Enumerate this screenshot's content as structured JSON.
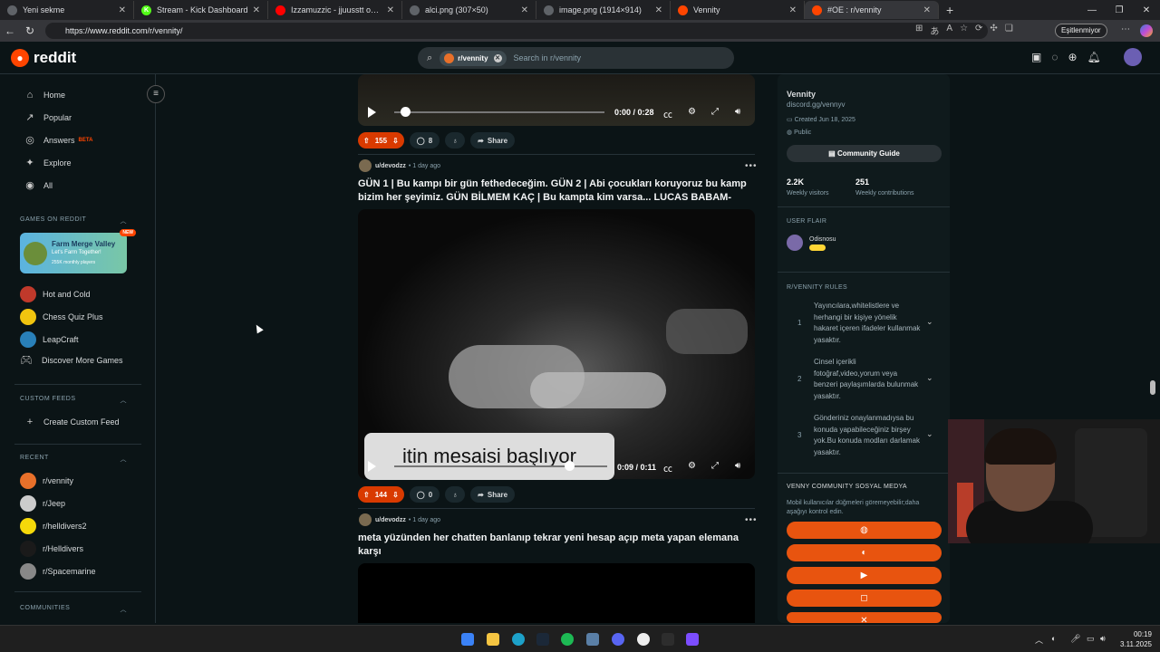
{
  "browser": {
    "tabs": [
      {
        "title": "Yeni sekme",
        "color": "#5f6368"
      },
      {
        "title": "Stream - Kick Dashboard",
        "color": "#53fc18",
        "glyph": "K"
      },
      {
        "title": "Izzamuzzic - jjuusstt oonnee (slo",
        "color": "#ff0000"
      },
      {
        "title": "alci.png (307×50)",
        "color": "#5f6368"
      },
      {
        "title": "image.png (1914×914)",
        "color": "#5f6368"
      },
      {
        "title": "Vennity",
        "color": "#ff4500"
      },
      {
        "title": "#OE : r/vennity",
        "color": "#ff4500"
      }
    ],
    "url": "https://www.reddit.com/r/vennity/",
    "sync_label": "Eşitlenmiyor"
  },
  "header": {
    "logo": "reddit",
    "search_chip": "r/vennity",
    "search_placeholder": "Search in r/vennity"
  },
  "sidebar": {
    "nav": [
      {
        "label": "Home",
        "icon": "home-icon",
        "glyph": "⌂"
      },
      {
        "label": "Popular",
        "icon": "popular-icon",
        "glyph": "↗"
      },
      {
        "label": "Answers",
        "icon": "answers-icon",
        "glyph": "◎"
      },
      {
        "label": "Explore",
        "icon": "explore-icon",
        "glyph": "✦"
      },
      {
        "label": "All",
        "icon": "all-icon",
        "glyph": "◉"
      }
    ],
    "answers_badge": "BETA",
    "games_header": "GAMES ON REDDIT",
    "promo": {
      "title": "Farm Merge Valley",
      "subtitle": "Let's Farm Together!",
      "meta": "255K monthly players",
      "badge": "NEW"
    },
    "games": [
      {
        "label": "Hot and Cold",
        "color": "#c0392b"
      },
      {
        "label": "Chess Quiz Plus",
        "color": "#f1c40f"
      },
      {
        "label": "LeapCraft",
        "color": "#2980b9"
      },
      {
        "label": "Discover More Games",
        "color": "#0b1416"
      }
    ],
    "custom_header": "CUSTOM FEEDS",
    "create_feed": "Create Custom Feed",
    "recent_header": "RECENT",
    "recent": [
      {
        "label": "r/vennity",
        "color": "#e8702a"
      },
      {
        "label": "r/Jeep",
        "color": "#cccccc"
      },
      {
        "label": "r/helldivers2",
        "color": "#f5d90a"
      },
      {
        "label": "r/Helldivers",
        "color": "#1a1a1a"
      },
      {
        "label": "r/Spacemarine",
        "color": "#888888"
      }
    ],
    "communities_header": "COMMUNITIES"
  },
  "feed": {
    "post0": {
      "time": "0:00 / 0:28",
      "votes": "155",
      "comments": "8",
      "share": "Share",
      "progress": 0.05
    },
    "post1": {
      "user": "u/devodzz",
      "age": "1 day ago",
      "title": "GÜN 1 | Bu kampı bir gün fethedeceğim. GÜN 2 | Abi çocukları koruyoruz bu kamp bizim her şeyimiz. GÜN BİLMEM KAÇ | Bu kampta kim varsa... LUCAS BABAM-",
      "overlay": "itin mesaisi başlıyor",
      "time": "0:09 / 0:11",
      "votes": "144",
      "comments": "0",
      "share": "Share",
      "progress": 0.82
    },
    "post2": {
      "user": "u/devodzz",
      "age": "1 day ago",
      "title": "meta yüzünden her chatten banlanıp tekrar yeni hesap açıp meta yapan elemana karşı"
    }
  },
  "right": {
    "name": "Vennity",
    "link": "discord.gg/vennyv",
    "created": "Created Jun 18, 2025",
    "visibility": "Public",
    "guide": "Community Guide",
    "visitors": "2.2K",
    "visitors_label": "Weekly visitors",
    "contrib": "251",
    "contrib_label": "Weekly contributions",
    "flair_header": "USER FLAIR",
    "flair_user": "Odisnosu",
    "rules_header": "R/VENNITY RULES",
    "rules": [
      {
        "n": "1",
        "text": "Yayıncılara,whitelistlere ve herhangi bir kişiye yönelik hakaret içeren ifadeler kullanmak yasaktır."
      },
      {
        "n": "2",
        "text": "Cinsel içerikli fotoğraf,video,yorum veya benzeri paylaşımlarda bulunmak yasaktır."
      },
      {
        "n": "3",
        "text": "Gönderiniz onaylanmadıysa bu konuda yapabileceğiniz birşey yok.Bu konuda modları darlamak yasaktır."
      }
    ],
    "social_header": "VENNY COMMUNITY SOSYAL MEDYA",
    "social_note": "Mobil kullanıcılar düğmeleri göremeyebilir;daha aşağıyı kontrol edin.",
    "social_buttons": [
      {
        "icon": "globe-icon",
        "glyph": "◍"
      },
      {
        "icon": "discord-icon",
        "glyph": "◐"
      },
      {
        "icon": "youtube-icon",
        "glyph": "▶"
      },
      {
        "icon": "instagram-icon",
        "glyph": "◻"
      },
      {
        "icon": "x-icon",
        "glyph": "✕"
      }
    ]
  },
  "taskbar": {
    "time": "00:19",
    "date": "3.11.2025"
  }
}
